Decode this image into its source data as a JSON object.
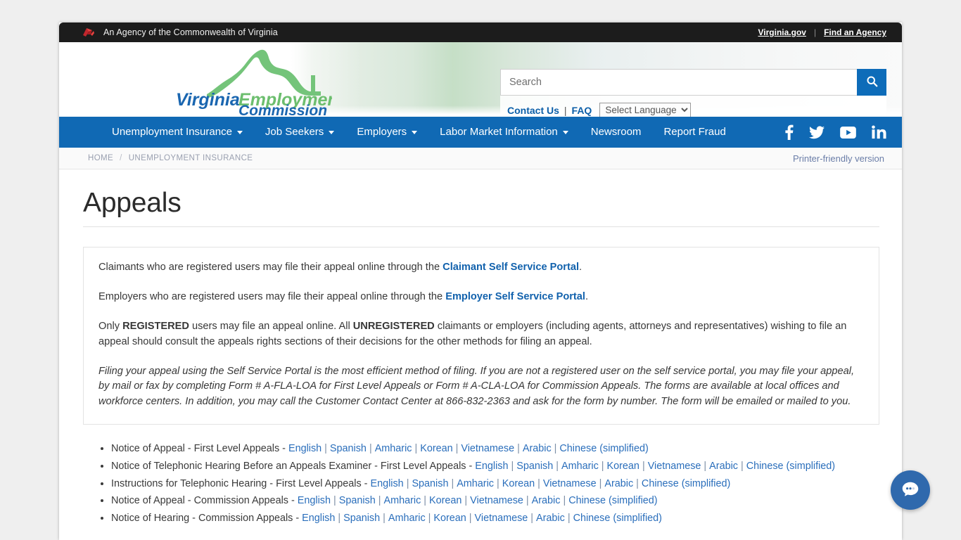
{
  "topbar": {
    "agency_icon": "virginia-flag-icon",
    "tagline": "An Agency of the Commonwealth of Virginia",
    "links": [
      {
        "label": "Virginia.gov"
      },
      {
        "label": "Find an Agency"
      }
    ],
    "separator": "|"
  },
  "logo": {
    "line1_a": "Virginia",
    "line1_b": "Employment",
    "line2": "Commission",
    "blue": "#1a66b0",
    "green": "#6cbe6e"
  },
  "search": {
    "placeholder": "Search",
    "value": "",
    "button_icon": "search-icon",
    "accent": "#0d6cb9"
  },
  "utility": {
    "contact_label": "Contact Us",
    "pipe": "|",
    "faq_label": "FAQ",
    "language_selected": "Select Language",
    "language_options": [
      "Select Language"
    ]
  },
  "nav": {
    "background": "#1069b4",
    "items": [
      {
        "label": "Unemployment Insurance",
        "has_caret": true
      },
      {
        "label": "Job Seekers",
        "has_caret": true
      },
      {
        "label": "Employers",
        "has_caret": true
      },
      {
        "label": "Labor Market Information",
        "has_caret": true
      },
      {
        "label": "Newsroom",
        "has_caret": false
      },
      {
        "label": "Report Fraud",
        "has_caret": false
      }
    ],
    "social": [
      {
        "name": "facebook-icon"
      },
      {
        "name": "twitter-icon"
      },
      {
        "name": "youtube-icon"
      },
      {
        "name": "linkedin-icon"
      }
    ]
  },
  "breadcrumb": {
    "items": [
      {
        "label": "HOME"
      },
      {
        "label": "UNEMPLOYMENT INSURANCE"
      }
    ],
    "separator": "/",
    "printer_label": "Printer-friendly version"
  },
  "main": {
    "title": "Appeals",
    "notice": {
      "p1_before": "Claimants who are registered users may file their appeal online through the ",
      "p1_link": "Claimant Self Service Portal",
      "p1_after": ".",
      "p2_before": "Employers who are registered users may file their appeal online through the ",
      "p2_link": "Employer Self Service Portal",
      "p2_after": ".",
      "p3_a": "Only ",
      "p3_b": "REGISTERED",
      "p3_c": " users may file an appeal online. All ",
      "p3_d": "UNREGISTERED",
      "p3_e": " claimants or employers (including agents, attorneys and representatives) wishing to file an appeal should consult the appeals rights sections of their decisions for the other methods for filing an appeal.",
      "p4": "Filing your appeal using the Self Service Portal is the most efficient method of filing.  If you are not a registered user on the self service portal, you may file your appeal, by mail or fax by completing Form # A-FLA-LOA for First Level Appeals or Form # A-CLA-LOA for Commission Appeals. The forms are available at local offices and workforce centers.  In addition, you may call the Customer Contact Center at 866-832-2363 and ask for the form by number. The form will be emailed or mailed to you."
    },
    "documents": [
      {
        "title": "Notice of Appeal - First Level Appeals - ",
        "languages": [
          "English",
          "Spanish",
          "Amharic",
          "Korean",
          "Vietnamese",
          "Arabic",
          "Chinese (simplified)"
        ]
      },
      {
        "title": "Notice of Telephonic Hearing Before an Appeals Examiner - First Level Appeals - ",
        "languages": [
          "English",
          "Spanish",
          "Amharic",
          "Korean",
          "Vietnamese",
          "Arabic",
          "Chinese (simplified)"
        ]
      },
      {
        "title": "Instructions for Telephonic Hearing - First Level Appeals - ",
        "languages": [
          "English",
          "Spanish",
          "Amharic",
          "Korean",
          "Vietnamese",
          "Arabic",
          "Chinese (simplified)"
        ]
      },
      {
        "title": "Notice of Appeal - Commission Appeals - ",
        "languages": [
          "English",
          "Spanish",
          "Amharic",
          "Korean",
          "Vietnamese",
          "Arabic",
          "Chinese (simplified)"
        ]
      },
      {
        "title": "Notice of Hearing - Commission Appeals - ",
        "languages": [
          "English",
          "Spanish",
          "Amharic",
          "Korean",
          "Vietnamese",
          "Arabic",
          "Chinese (simplified)"
        ]
      }
    ],
    "list_pipe": "|"
  },
  "chat": {
    "icon": "chat-bubble-icon",
    "color": "#2f69ad"
  }
}
